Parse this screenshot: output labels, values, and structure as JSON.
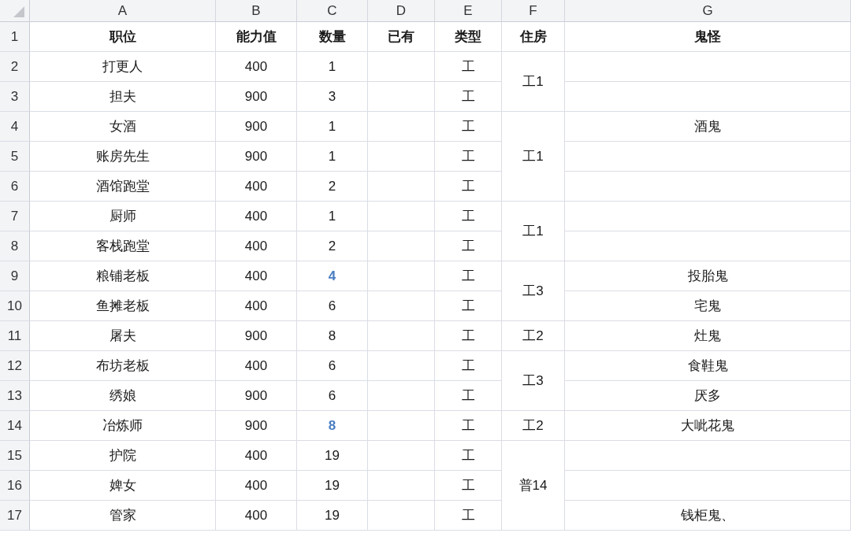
{
  "columns": [
    "A",
    "B",
    "C",
    "D",
    "E",
    "F",
    "G"
  ],
  "header": {
    "row_number": "1",
    "cells": [
      "职位",
      "能力值",
      "数量",
      "已有",
      "类型",
      "住房",
      "鬼怪"
    ]
  },
  "rows": [
    {
      "row_number": "2",
      "position": "打更人",
      "ability": "400",
      "quantity": "1",
      "quantity_highlighted": false,
      "type": "工",
      "housing": "工1"
    },
    {
      "row_number": "3",
      "position": "担夫",
      "ability": "900",
      "quantity": "3",
      "quantity_highlighted": false,
      "type": "工"
    },
    {
      "row_number": "4",
      "position": "女酒",
      "ability": "900",
      "quantity": "1",
      "quantity_highlighted": false,
      "type": "工",
      "housing": "工1",
      "ghost": "酒鬼"
    },
    {
      "row_number": "5",
      "position": "账房先生",
      "ability": "900",
      "quantity": "1",
      "quantity_highlighted": false,
      "type": "工"
    },
    {
      "row_number": "6",
      "position": "酒馆跑堂",
      "ability": "400",
      "quantity": "2",
      "quantity_highlighted": false,
      "type": "工"
    },
    {
      "row_number": "7",
      "position": "厨师",
      "ability": "400",
      "quantity": "1",
      "quantity_highlighted": false,
      "type": "工",
      "housing": "工1"
    },
    {
      "row_number": "8",
      "position": "客栈跑堂",
      "ability": "400",
      "quantity": "2",
      "quantity_highlighted": false,
      "type": "工"
    },
    {
      "row_number": "9",
      "position": "粮铺老板",
      "ability": "400",
      "quantity": "4",
      "quantity_highlighted": true,
      "type": "工",
      "housing": "工3",
      "ghost": "投胎鬼"
    },
    {
      "row_number": "10",
      "position": "鱼摊老板",
      "ability": "400",
      "quantity": "6",
      "quantity_highlighted": false,
      "type": "工",
      "ghost": "宅鬼"
    },
    {
      "row_number": "11",
      "position": "屠夫",
      "ability": "900",
      "quantity": "8",
      "quantity_highlighted": false,
      "type": "工",
      "housing": "工2",
      "ghost": "灶鬼"
    },
    {
      "row_number": "12",
      "position": "布坊老板",
      "ability": "400",
      "quantity": "6",
      "quantity_highlighted": false,
      "type": "工",
      "housing": "工3",
      "ghost": "食鞋鬼"
    },
    {
      "row_number": "13",
      "position": "绣娘",
      "ability": "900",
      "quantity": "6",
      "quantity_highlighted": false,
      "type": "工",
      "ghost": "厌多"
    },
    {
      "row_number": "14",
      "position": "冶炼师",
      "ability": "900",
      "quantity": "8",
      "quantity_highlighted": true,
      "type": "工",
      "housing": "工2",
      "ghost": "大呲花鬼"
    },
    {
      "row_number": "15",
      "position": "护院",
      "ability": "400",
      "quantity": "19",
      "quantity_highlighted": false,
      "type": "工",
      "housing": "普14"
    },
    {
      "row_number": "16",
      "position": "婢女",
      "ability": "400",
      "quantity": "19",
      "quantity_highlighted": false,
      "type": "工"
    },
    {
      "row_number": "17",
      "position": "管家",
      "ability": "400",
      "quantity": "19",
      "quantity_highlighted": false,
      "type": "工",
      "ghost": "钱柜鬼、"
    }
  ]
}
